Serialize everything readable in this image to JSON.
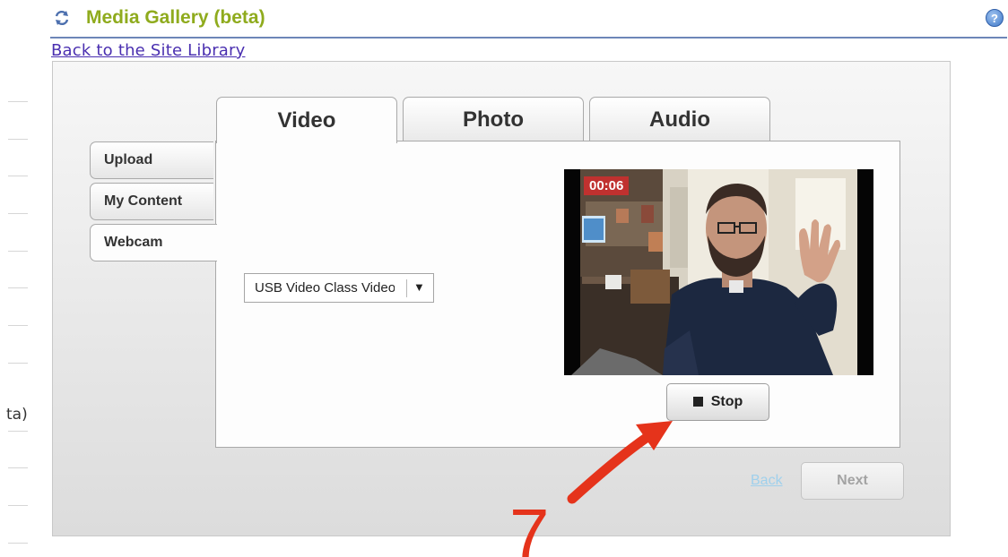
{
  "header": {
    "title": "Media Gallery (beta)",
    "help_glyph": "?"
  },
  "links": {
    "back_to_library": "Back to the Site Library"
  },
  "left_partial_text": "ta)",
  "tabs": [
    {
      "label": "Video",
      "active": true
    },
    {
      "label": "Photo",
      "active": false
    },
    {
      "label": "Audio",
      "active": false
    }
  ],
  "side_tabs": [
    {
      "label": "Upload",
      "active": false
    },
    {
      "label": "My Content",
      "active": false
    },
    {
      "label": "Webcam",
      "active": true
    }
  ],
  "camera_select": {
    "value": "USB Video Class Video",
    "arrow": "▼"
  },
  "video": {
    "timer": "00:06"
  },
  "buttons": {
    "stop": "Stop",
    "back": "Back",
    "next": "Next"
  },
  "annotation": {
    "step": "7",
    "color": "#e5331b"
  },
  "colors": {
    "title": "#8fab1d",
    "link": "#4a2fb0",
    "rule": "#6d86b8"
  }
}
